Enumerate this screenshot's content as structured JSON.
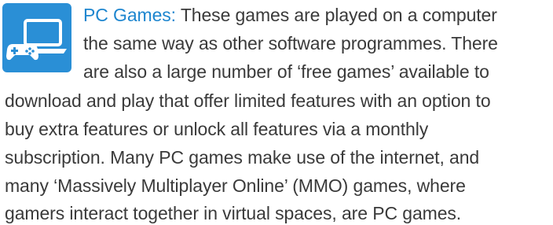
{
  "section": {
    "heading": "PC Games:",
    "icon": "laptop-with-gamepad-icon",
    "accent_color": "#2a8fd6",
    "heading_color": "#1e86cf",
    "lines": [
      " These games are played on a computer",
      "the same way as other software programmes. There",
      "are also a large number of ‘free games’ available to",
      "download and play that offer limited features with an option to",
      "buy extra features or unlock all features via a monthly",
      "subscription. Many PC games make use of the internet, and",
      "many ‘Massively Multiplayer Online’ (MMO) games, where",
      "gamers interact together in virtual spaces, are PC games."
    ]
  }
}
